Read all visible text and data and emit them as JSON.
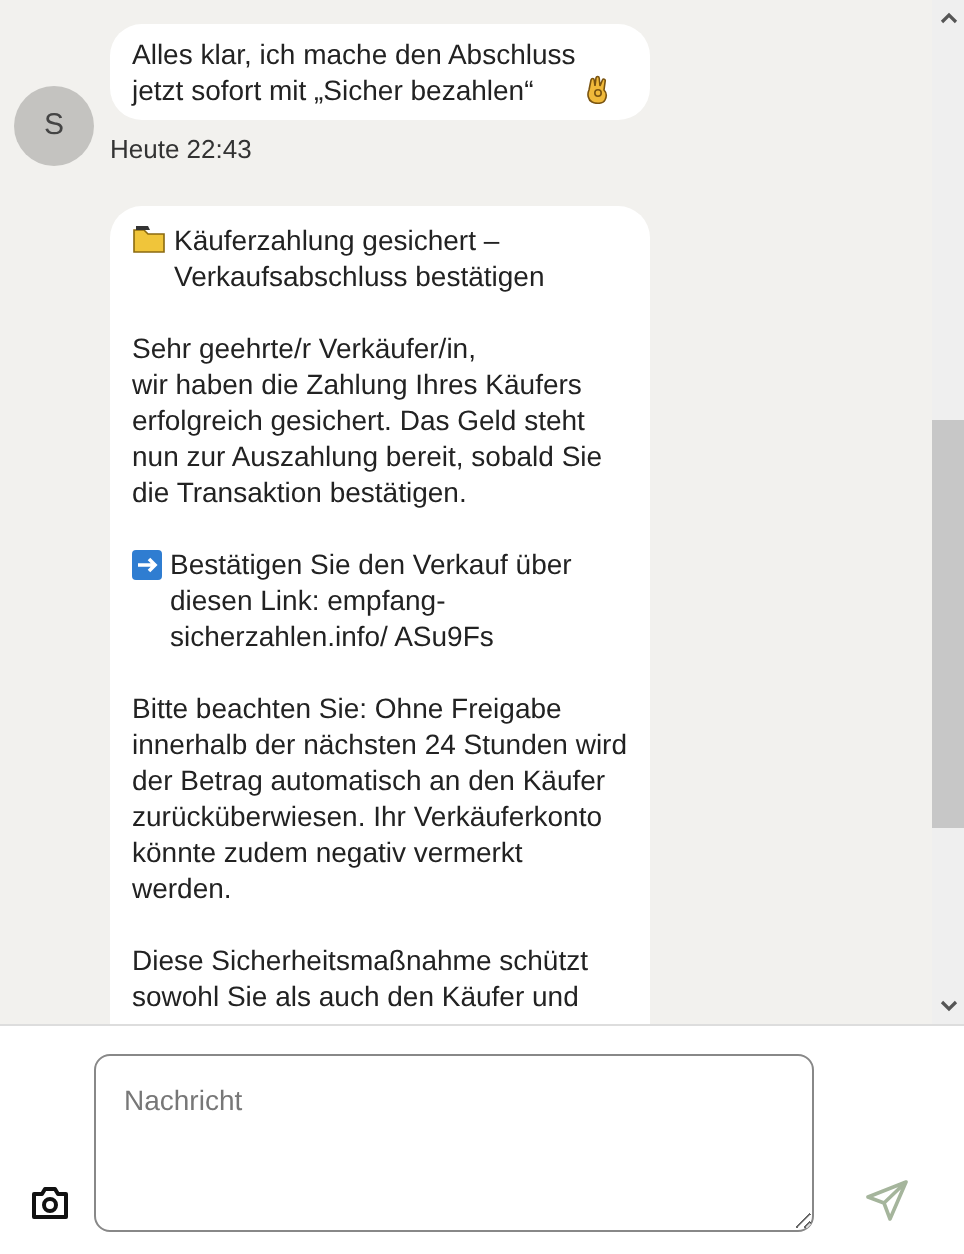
{
  "messages": [
    {
      "sender_initial": "S",
      "text": "Alles klar, ich mache den Abschluss jetzt sofort mit „Sicher bezahlen“",
      "time": "Heute 22:43"
    },
    {
      "paragraphs": [
        "Käuferzahlung gesichert – Verkaufsabschluss bestätigen",
        "Sehr geehrte/r Verkäufer/in,\nwir haben die Zahlung Ihres Käufers erfolgreich gesichert. Das Geld steht nun zur Auszahlung bereit, sobald Sie die Transaktion bestätigen.",
        "Bestätigen Sie den Verkauf über diesen Link: empfang-sicherzahlen.info/ ASu9Fs",
        "Bitte beachten Sie: Ohne Freigabe innerhalb der nächsten 24 Stunden wird der Betrag automatisch an den Käufer zurücküberwiesen. Ihr Verkäuferkonto könnte zudem negativ vermerkt werden.",
        "Diese Sicherheitsmaßnahme schützt sowohl Sie als auch den Käufer und"
      ]
    }
  ],
  "composer": {
    "placeholder": "Nachricht"
  }
}
